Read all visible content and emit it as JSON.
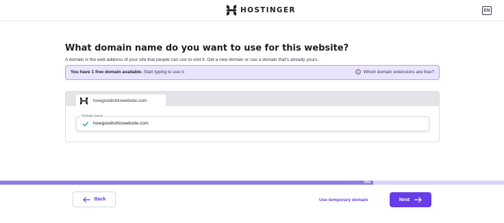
{
  "header": {
    "brand": "HOSTINGER",
    "language_label": "EN"
  },
  "main": {
    "title": "What domain name do you want to use for this website?",
    "subtitle": "A domain is the web address of your site that people can use to visit it. Get a new domain or use a domain that's already yours.",
    "banner": {
      "bold_text": "You have 1 free domain available.",
      "rest_text": " Start typing to use it.",
      "help_link": "Which domain extensions are free?"
    },
    "preview_tab": {
      "label": "howgoodisthiswebsite.com"
    },
    "domain_field": {
      "label": "Domain name",
      "value": "howgoodisthiswebsite.com",
      "valid": true
    }
  },
  "progress": {
    "percent": 74,
    "label": "74%"
  },
  "footer": {
    "back_label": "Back",
    "temp_domain_label": "Use temporary domain",
    "next_label": "Next"
  },
  "colors": {
    "accent": "#673de6",
    "banner_bg": "#ebe4ff",
    "banner_border": "#b39ef3",
    "progress_fill": "#8c7ee6",
    "progress_track": "#d8d4f5",
    "valid_check": "#00b090"
  },
  "icons": {
    "logo": "hostinger-logo-icon",
    "info": "info-circle-icon",
    "favicon": "hostinger-favicon-icon",
    "check": "check-icon",
    "back": "arrow-left-icon",
    "next": "arrow-right-icon"
  }
}
